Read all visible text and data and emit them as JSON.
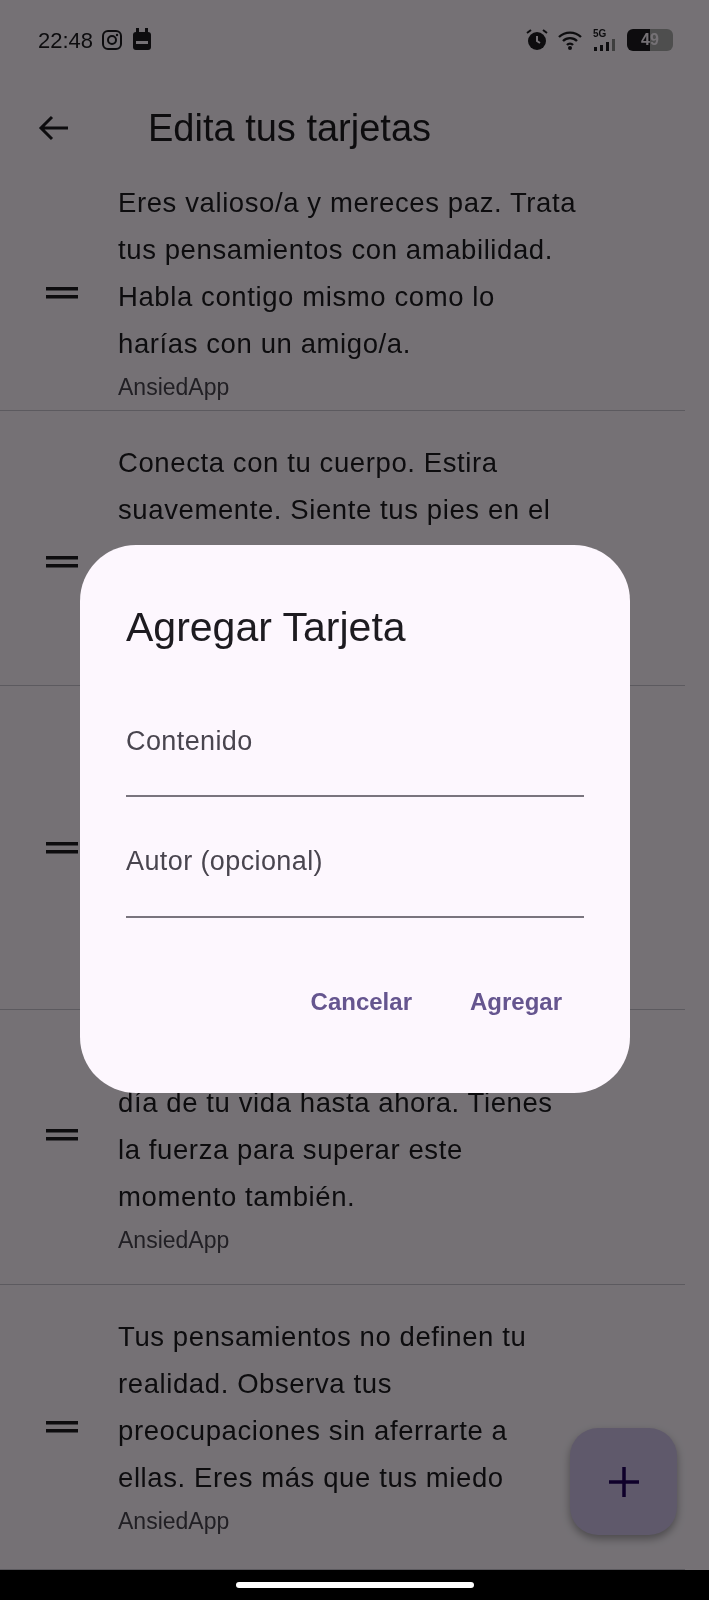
{
  "status_bar": {
    "time": "22:48",
    "network": "5G",
    "battery": "49"
  },
  "app_bar": {
    "title": "Edita tus tarjetas"
  },
  "cards": [
    {
      "draggable": true,
      "lines": [
        "Eres valioso/a y mereces paz. Trata",
        "tus pensamientos con amabilidad.",
        "Habla contigo mismo como lo",
        "harías con un amigo/a."
      ],
      "author": "AnsiedApp"
    },
    {
      "draggable": true,
      "lines": [
        "Conecta con tu cuerpo. Estira",
        "suavemente. Siente tus pies en el"
      ]
    },
    {
      "draggable": true
    },
    {
      "draggable": true,
      "lines": [
        "día de tu vida hasta ahora. Tienes",
        "la fuerza para superar este",
        "momento también."
      ],
      "author": "AnsiedApp"
    },
    {
      "draggable": true,
      "lines": [
        "Tus pensamientos no definen tu",
        "realidad. Observa tus",
        "preocupaciones sin aferrarte a",
        "ellas. Eres más que tus miedo"
      ],
      "author": "AnsiedApp"
    }
  ],
  "dialog": {
    "title": "Agregar Tarjeta",
    "fields": [
      {
        "placeholder": "Contenido"
      },
      {
        "placeholder": "Autor (opcional)"
      }
    ],
    "actions": [
      "Cancelar",
      "Agregar"
    ]
  }
}
